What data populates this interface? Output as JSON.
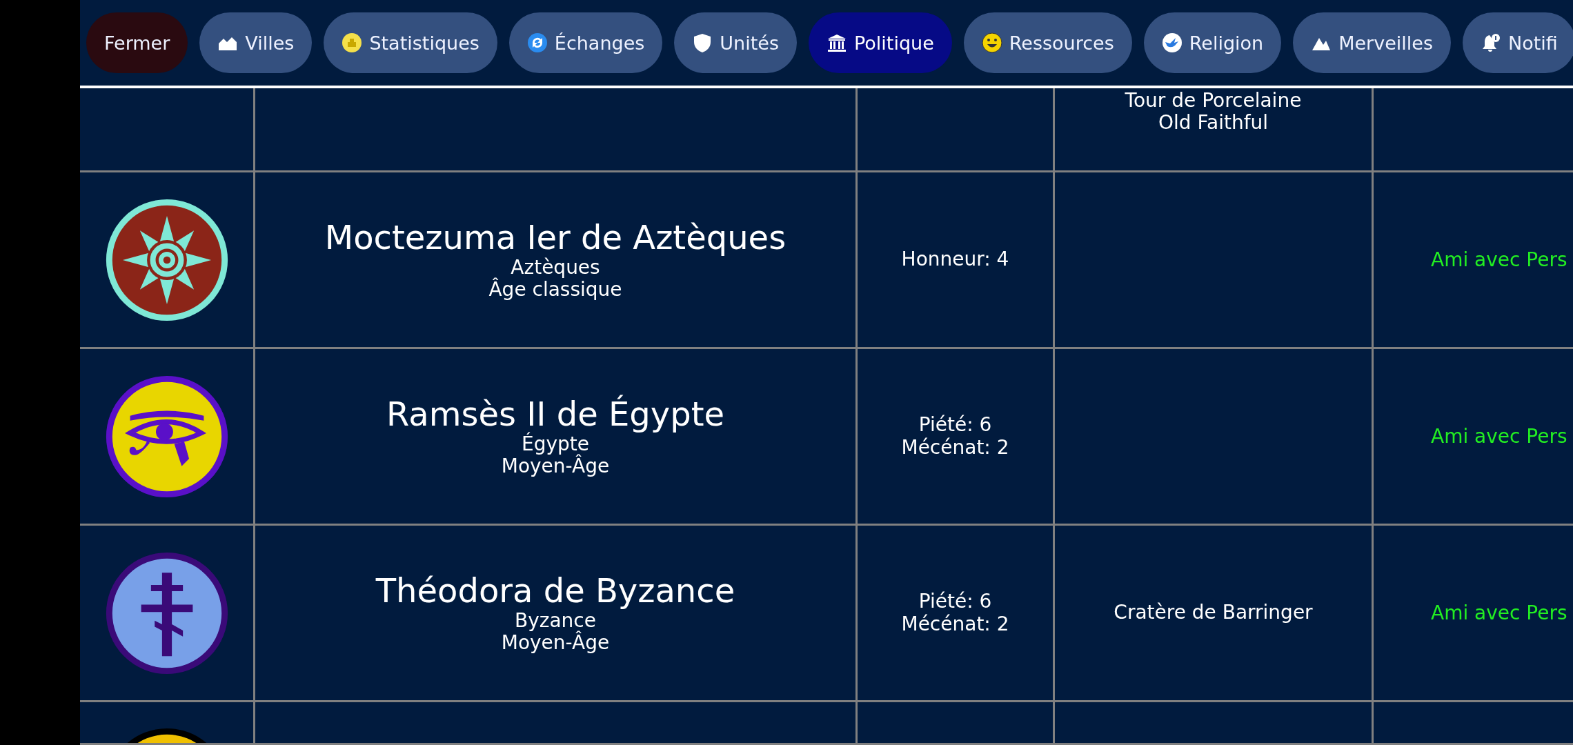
{
  "tabs": [
    {
      "label": "Fermer",
      "kind": "close"
    },
    {
      "label": "Villes",
      "kind": "cities",
      "selected": false
    },
    {
      "label": "Statistiques",
      "kind": "stats",
      "selected": false
    },
    {
      "label": "Échanges",
      "kind": "trades",
      "selected": false
    },
    {
      "label": "Unités",
      "kind": "units",
      "selected": false
    },
    {
      "label": "Politique",
      "kind": "politics",
      "selected": true
    },
    {
      "label": "Ressources",
      "kind": "resources",
      "selected": false
    },
    {
      "label": "Religion",
      "kind": "religion",
      "selected": false
    },
    {
      "label": "Merveilles",
      "kind": "wonders",
      "selected": false
    },
    {
      "label": "Notifi",
      "kind": "notifications",
      "selected": false
    }
  ],
  "rows": [
    {
      "name": "",
      "civ": "",
      "era": "",
      "policies": [],
      "wonders": [
        "Tour de Porcelaine",
        "Old Faithful"
      ],
      "relation": ""
    },
    {
      "kind": "aztec",
      "name": "Moctezuma Ier de Aztèques",
      "civ": "Aztèques",
      "era": "Âge classique",
      "policies": [
        "Honneur: 4"
      ],
      "wonders": [],
      "relation": "Ami avec Pers"
    },
    {
      "kind": "egypt",
      "name": "Ramsès II de Égypte",
      "civ": "Égypte",
      "era": "Moyen-Âge",
      "policies": [
        "Piété: 6",
        "Mécénat: 2"
      ],
      "wonders": [],
      "relation": "Ami avec Pers"
    },
    {
      "kind": "byzantium",
      "name": "Théodora de Byzance",
      "civ": "Byzance",
      "era": "Moyen-Âge",
      "policies": [
        "Piété: 6",
        "Mécénat: 2"
      ],
      "wonders": [
        "Cratère de Barringer"
      ],
      "relation": "Ami avec Pers"
    },
    {
      "kind": "sun",
      "name": "",
      "civ": "",
      "era": "",
      "policies": [],
      "wonders": [],
      "relation": ""
    }
  ]
}
